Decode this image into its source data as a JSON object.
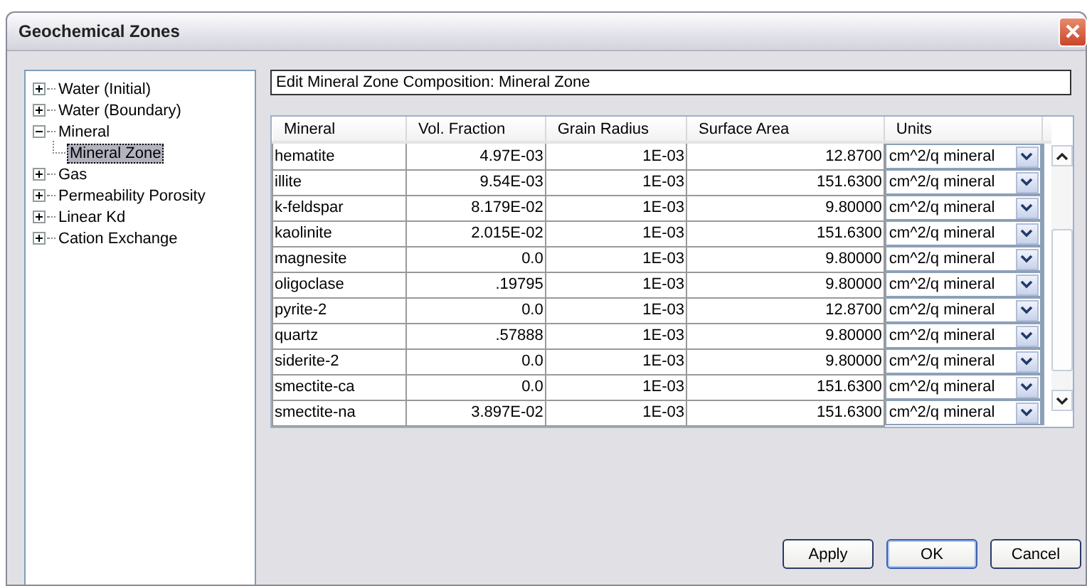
{
  "window": {
    "title": "Geochemical Zones"
  },
  "tree": [
    {
      "label": "Water (Initial)",
      "expanded": false,
      "selected": false
    },
    {
      "label": "Water (Boundary)",
      "expanded": false,
      "selected": false
    },
    {
      "label": "Mineral",
      "expanded": true,
      "selected": false,
      "children": [
        {
          "label": "Mineral Zone",
          "selected": true
        }
      ]
    },
    {
      "label": "Gas",
      "expanded": false,
      "selected": false
    },
    {
      "label": "Permeability Porosity",
      "expanded": false,
      "selected": false
    },
    {
      "label": "Linear Kd",
      "expanded": false,
      "selected": false
    },
    {
      "label": "Cation Exchange",
      "expanded": false,
      "selected": false
    }
  ],
  "heading": "Edit Mineral Zone Composition: Mineral Zone",
  "table": {
    "columns": [
      "Mineral",
      "Vol. Fraction",
      "Grain Radius",
      "Surface Area",
      "Units"
    ],
    "rows": [
      [
        "hematite",
        "4.97E-03",
        "1E-03",
        "12.8700",
        "cm^2/q mineral"
      ],
      [
        "illite",
        "9.54E-03",
        "1E-03",
        "151.6300",
        "cm^2/q mineral"
      ],
      [
        "k-feldspar",
        "8.179E-02",
        "1E-03",
        "9.80000",
        "cm^2/q mineral"
      ],
      [
        "kaolinite",
        "2.015E-02",
        "1E-03",
        "151.6300",
        "cm^2/q mineral"
      ],
      [
        "magnesite",
        "0.0",
        "1E-03",
        "9.80000",
        "cm^2/q mineral"
      ],
      [
        "oligoclase",
        ".19795",
        "1E-03",
        "9.80000",
        "cm^2/q mineral"
      ],
      [
        "pyrite-2",
        "0.0",
        "1E-03",
        "12.8700",
        "cm^2/q mineral"
      ],
      [
        "quartz",
        ".57888",
        "1E-03",
        "9.80000",
        "cm^2/q mineral"
      ],
      [
        "siderite-2",
        "0.0",
        "1E-03",
        "9.80000",
        "cm^2/q mineral"
      ],
      [
        "smectite-ca",
        "0.0",
        "1E-03",
        "151.6300",
        "cm^2/q mineral"
      ],
      [
        "smectite-na",
        "3.897E-02",
        "1E-03",
        "151.6300",
        "cm^2/q mineral"
      ]
    ]
  },
  "buttons": [
    {
      "label": "Apply",
      "default": false
    },
    {
      "label": "OK",
      "default": true
    },
    {
      "label": "Cancel",
      "default": false
    }
  ]
}
